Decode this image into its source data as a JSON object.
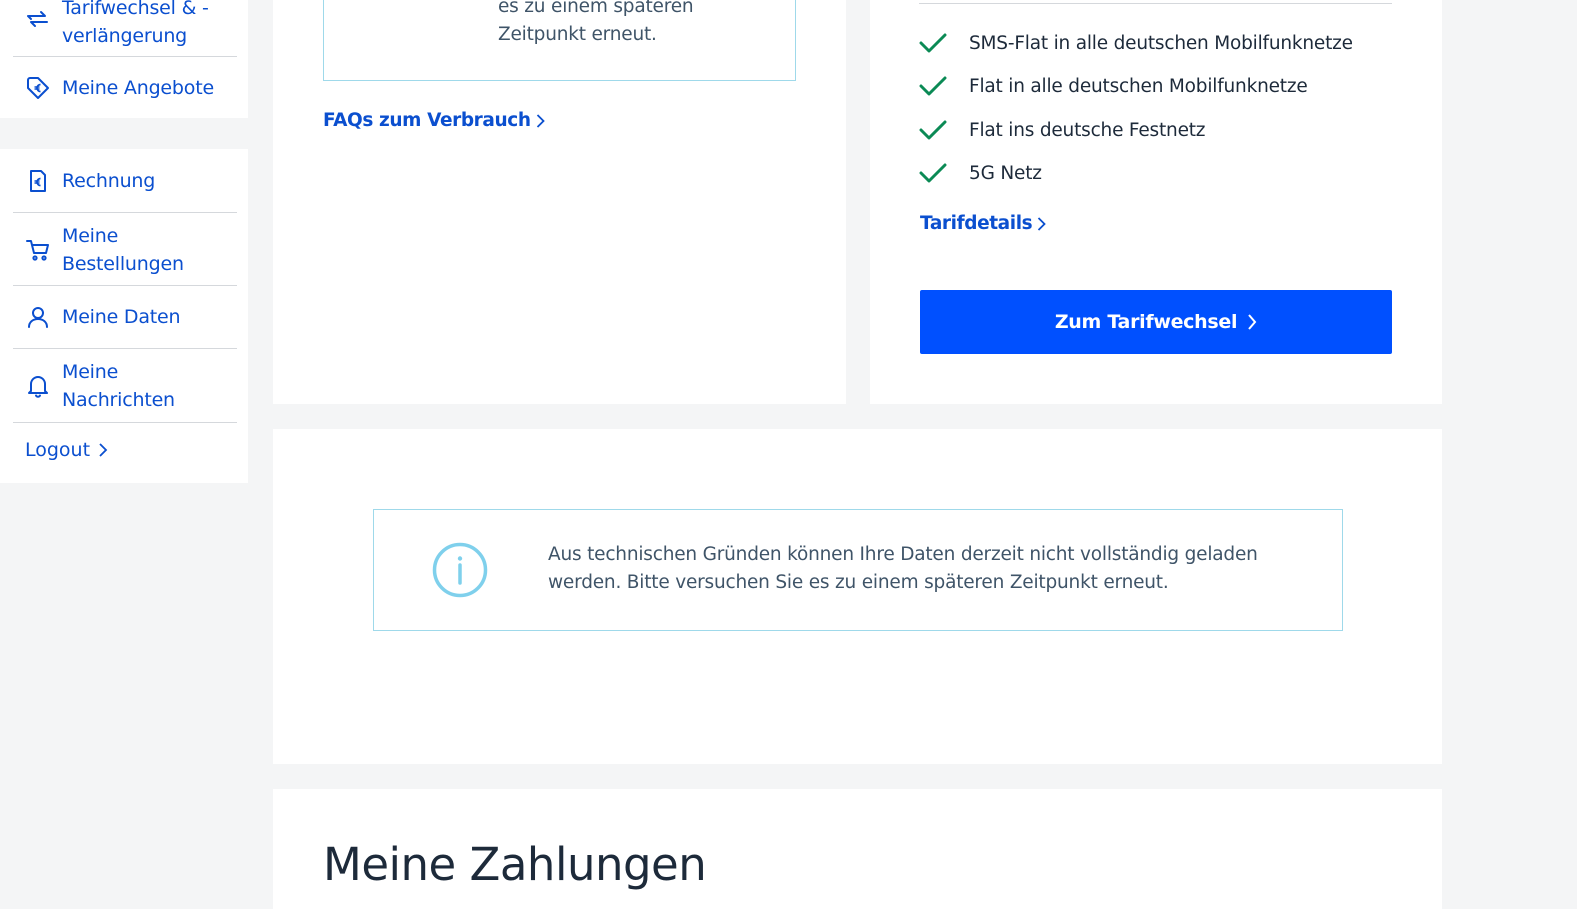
{
  "sidebar": {
    "group1": [
      {
        "label_line1": "Tarifwechsel & -",
        "label_line2": "verlängerung",
        "icon": "swap-arrows-icon"
      },
      {
        "label": "Meine Angebote",
        "icon": "euro-tag-icon"
      }
    ],
    "group2": [
      {
        "label": "Rechnung",
        "icon": "euro-document-icon"
      },
      {
        "label_line1": "Meine",
        "label_line2": "Bestellungen",
        "icon": "cart-icon"
      },
      {
        "label": "Meine Daten",
        "icon": "person-icon"
      },
      {
        "label_line1": "Meine",
        "label_line2": "Nachrichten",
        "icon": "bell-icon"
      }
    ],
    "logout": "Logout"
  },
  "usage_card": {
    "error_line1": "es zu einem späteren",
    "error_line2": "Zeitpunkt erneut.",
    "faq_link": "FAQs zum Verbrauch"
  },
  "tariff_card": {
    "features": [
      "SMS-Flat in alle deutschen Mobilfunknetze",
      "Flat in alle deutschen Mobilfunknetze",
      "Flat ins deutsche Festnetz",
      "5G Netz"
    ],
    "details_link": "Tarifdetails",
    "cta_button": "Zum Tarifwechsel"
  },
  "notice": {
    "line1": "Aus technischen Gründen können Ihre Daten derzeit nicht vollständig geladen",
    "line2": "werden. Bitte versuchen Sie es zu einem späteren Zeitpunkt erneut."
  },
  "payments": {
    "title": "Meine Zahlungen"
  },
  "colors": {
    "link": "#0b4fcf",
    "primary_button": "#0050ff",
    "check": "#0b8a55",
    "info_border": "#9fd9ea"
  }
}
